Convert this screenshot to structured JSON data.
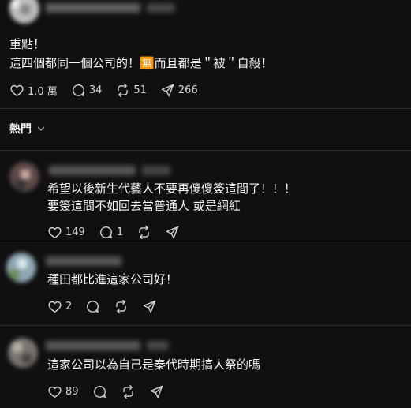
{
  "post": {
    "text_line1": "重點！",
    "text_line2": "這四個都同一個公司的！🈚而且都是＂被＂自殺！",
    "likes": "1.0 萬",
    "comments": "34",
    "reposts": "51",
    "shares": "266"
  },
  "sort": {
    "label": "熱門"
  },
  "replies": [
    {
      "line1": "希望以後新生代藝人不要再傻傻簽這間了！！！",
      "line2": "要簽這間不如回去當普通人 或是網紅",
      "likes": "149",
      "comments": "1"
    },
    {
      "line1": "種田都比進這家公司好！",
      "likes": "2"
    },
    {
      "line1": "這家公司以為自己是秦代時期搞人祭的嗎",
      "likes": "89"
    }
  ],
  "icons": [
    "heart-icon",
    "comment-icon",
    "repost-icon",
    "share-icon",
    "chevron-down-icon"
  ]
}
